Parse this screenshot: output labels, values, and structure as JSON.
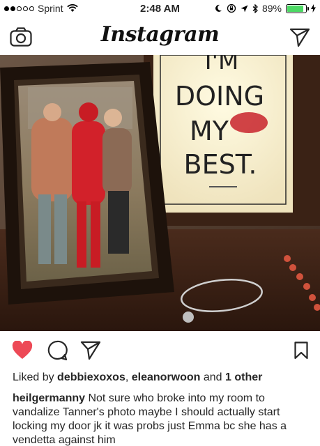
{
  "status_bar": {
    "carrier": "Sprint",
    "time": "2:48 AM",
    "battery": "89%",
    "battery_level": 0.89
  },
  "header": {
    "title": "Instagram",
    "left_icon": "camera-icon",
    "right_icon": "direct-send-icon"
  },
  "post": {
    "photo_text": {
      "line1": "I'M",
      "line2": "DOING",
      "line3": "MY",
      "line4": "BEST."
    },
    "likes": {
      "prefix": "Liked by ",
      "user1": "debbiexoxos",
      "sep": ", ",
      "user2": "eleanorwoon",
      "and": " and ",
      "others": "1 other"
    },
    "caption": {
      "username": "heilgermanny",
      "text": " Not sure who broke into my room to vandalize Tanner's photo maybe I should actually start locking my door jk it was probs just Emma bc she has a vendetta against him"
    }
  },
  "colors": {
    "like_red": "#ed4956",
    "battery_green": "#4cd964"
  }
}
